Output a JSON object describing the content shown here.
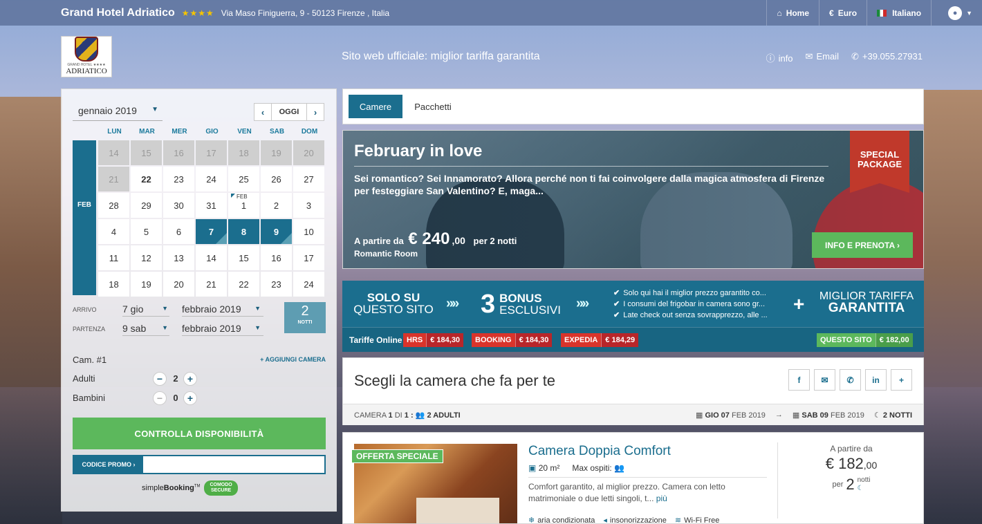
{
  "topbar": {
    "hotel_name": "Grand Hotel Adriatico",
    "stars": "★★★★",
    "address": "Via Maso Finiguerra, 9 - 50123 Firenze , Italia",
    "nav": [
      {
        "icon": "home-icon",
        "glyph": "⌂",
        "label": "Home"
      },
      {
        "icon": "euro-icon",
        "glyph": "€",
        "label": "Euro"
      },
      {
        "icon": "flag-italy-icon",
        "label": "Italiano"
      }
    ]
  },
  "header": {
    "logo_small": "GRAND HOTEL ★★★★",
    "logo_big": "ADRIATICO",
    "tagline": "Sito web ufficiale: miglior tariffa garantita",
    "info_label": "info",
    "email_label": "Email",
    "phone": "+39.055.27931"
  },
  "calendar": {
    "month_label": "gennaio 2019",
    "today_label": "OGGI",
    "weekdays": [
      "LUN",
      "MAR",
      "MER",
      "GIO",
      "VEN",
      "SAB",
      "DOM"
    ],
    "strip_label": "FEB",
    "weeks": [
      [
        "14",
        "15",
        "16",
        "17",
        "18",
        "19",
        "20"
      ],
      [
        "21",
        "22",
        "23",
        "24",
        "25",
        "26",
        "27"
      ],
      [
        "28",
        "29",
        "30",
        "31",
        "1",
        "2",
        "3"
      ],
      [
        "4",
        "5",
        "6",
        "7",
        "8",
        "9",
        "10"
      ],
      [
        "11",
        "12",
        "13",
        "14",
        "15",
        "16",
        "17"
      ],
      [
        "18",
        "19",
        "20",
        "21",
        "22",
        "23",
        "24"
      ]
    ],
    "feb_tag": "FEB"
  },
  "stay": {
    "arrival_label": "ARRIVO",
    "arrival_day": "7 gio",
    "arrival_month": "febbraio 2019",
    "departure_label": "PARTENZA",
    "departure_day": "9 sab",
    "departure_month": "febbraio 2019",
    "nights_count": "2",
    "nights_label": "NOTTI"
  },
  "rooms": {
    "room_label": "Cam. #1",
    "add_room": "+ AGGIUNGI CAMERA",
    "adults_label": "Adulti",
    "adults": "2",
    "children_label": "Bambini",
    "children": "0"
  },
  "check_button": "CONTROLLA DISPONIBILITÀ",
  "promo_code_label": "CODICE PROMO",
  "brand": {
    "simple": "simple",
    "booking": "Booking",
    "tm": "TM",
    "secure_top": "COMODO",
    "secure_bottom": "SECURE"
  },
  "tabs": [
    "Camere",
    "Pacchetti"
  ],
  "package": {
    "title": "February in love",
    "description": "Sei romantico? Sei Innamorato? Allora perché non ti fai coinvolgere dalla magica atmosfera di Firenze per festeggiare San Valentino? E, maga...",
    "from_label": "A partire da",
    "price": "€ 240",
    "cents": ",00",
    "per": "per 2 notti",
    "room": "Romantic Room",
    "ribbon_line1": "SPECIAL",
    "ribbon_line2": "PACKAGE",
    "cta": "INFO E PRENOTA ›"
  },
  "bonus": {
    "b1_line1": "SOLO SU",
    "b1_line2": "QUESTO SITO",
    "arrows": "»»",
    "count": "3",
    "b2_line1": "BONUS",
    "b2_line2": "ESCLUSIVI",
    "list": [
      "Solo qui hai il miglior prezzo garantito co...",
      "I consumi del frigobar in camera sono gr...",
      "Late check out senza sovrapprezzo, alle ..."
    ],
    "plus": "+",
    "best_line1": "MIGLIOR TARIFFA",
    "best_line2": "GARANTITA",
    "rates_label": "Tariffe Online",
    "rates": [
      {
        "name": "HRS",
        "price": "€ 184,30"
      },
      {
        "name": "BOOKING",
        "price": "€ 184,30"
      },
      {
        "name": "EXPEDIA",
        "price": "€ 184,29"
      }
    ],
    "site_rate": {
      "name": "QUESTO SITO",
      "price": "€ 182,00"
    }
  },
  "choose": {
    "title": "Scegli la camera che fa per te",
    "share": [
      {
        "icon": "facebook-icon",
        "glyph": "f"
      },
      {
        "icon": "email-icon",
        "glyph": "✉"
      },
      {
        "icon": "whatsapp-icon",
        "glyph": "✆"
      },
      {
        "icon": "linkedin-icon",
        "glyph": "in"
      },
      {
        "icon": "plus-icon",
        "glyph": "+"
      }
    ],
    "camera_prefix": "CAMERA",
    "camera_num": "1",
    "camera_di": "DI",
    "camera_total": "1 :",
    "adults_text": "2 ADULTI",
    "checkin_day": "GIO 07",
    "checkin_rest": "FEB 2019",
    "arrow": "→",
    "checkout_day": "SAB 09",
    "checkout_rest": "FEB 2019",
    "nights": "2 NOTTI"
  },
  "room": {
    "offer_badge": "OFFERTA SPECIALE",
    "name": "Camera Doppia Comfort",
    "size": "20 m²",
    "guests_label": "Max ospiti:",
    "description": "Comfort garantito, al miglior prezzo. Camera con letto matrimoniale o due letti singoli, t...",
    "more": "più",
    "amenities": [
      {
        "icon": "snowflake-icon",
        "glyph": "❄",
        "label": "aria condizionata"
      },
      {
        "icon": "speaker-icon",
        "glyph": "◂",
        "label": "insonorizzazione"
      },
      {
        "icon": "wifi-icon",
        "glyph": "≋",
        "label": "Wi-Fi Free"
      }
    ],
    "from_label": "A partire da",
    "price": "€ 182",
    "cents": ",00",
    "per_label": "per",
    "nights": "2",
    "nights_label": "notti"
  },
  "colors": {
    "accent": "#1b6e8e",
    "green": "#5cb85c",
    "red": "#d9342b"
  }
}
